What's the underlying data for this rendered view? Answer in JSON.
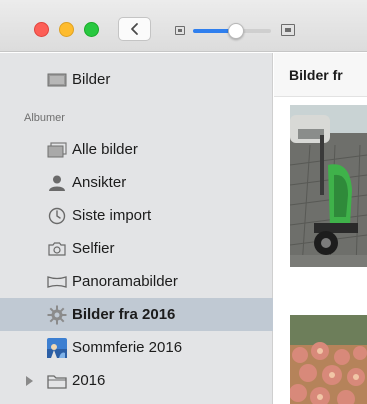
{
  "window": {
    "zoom_level": 0.55
  },
  "sidebar": {
    "library_label": "Bilder",
    "section_label": "Albumer",
    "items": [
      {
        "label": "Alle bilder",
        "icon": "all-photos-icon"
      },
      {
        "label": "Ansikter",
        "icon": "person-icon"
      },
      {
        "label": "Siste import",
        "icon": "clock-icon"
      },
      {
        "label": "Selfier",
        "icon": "camera-icon"
      },
      {
        "label": "Panoramabilder",
        "icon": "panorama-icon"
      },
      {
        "label": "Bilder fra 2016",
        "icon": "gear-icon",
        "selected": true
      },
      {
        "label": "Sommferie 2016",
        "icon": "album-thumbnail-icon"
      },
      {
        "label": "2016",
        "icon": "folder-icon"
      }
    ]
  },
  "content": {
    "title": "Bilder fr"
  },
  "colors": {
    "sidebar_bg": "#e3e4e6",
    "selected_bg": "#c0c9d3",
    "accent": "#2f7fee",
    "close": "#fd5f57",
    "minimize": "#febc2e",
    "maximize": "#28c840"
  }
}
